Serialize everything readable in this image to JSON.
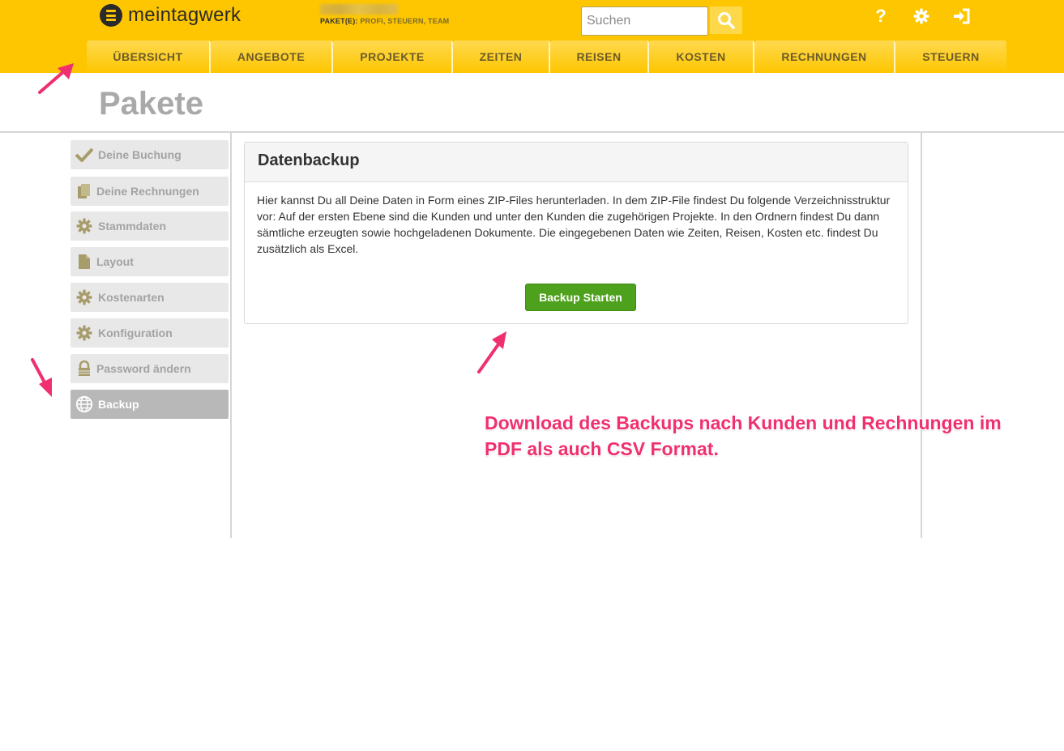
{
  "header": {
    "logo_text": "meintagwerk",
    "package_label": "PAKET(E):",
    "package_value": "PROFI, STEUERN, TEAM",
    "search_placeholder": "Suchen",
    "help_icon": "question-icon",
    "settings_icon": "gear-icon",
    "logout_icon": "sign-in-icon"
  },
  "nav": [
    {
      "label": "ÜBERSICHT"
    },
    {
      "label": "ANGEBOTE"
    },
    {
      "label": "PROJEKTE"
    },
    {
      "label": "ZEITEN"
    },
    {
      "label": "REISEN"
    },
    {
      "label": "KOSTEN"
    },
    {
      "label": "RECHNUNGEN"
    },
    {
      "label": "STEUERN"
    }
  ],
  "page": {
    "title": "Pakete"
  },
  "sidebar": [
    {
      "label": "Deine Buchung",
      "icon": "check-icon"
    },
    {
      "label": "Deine Rechnungen",
      "icon": "documents-icon"
    },
    {
      "label": "Stammdaten",
      "icon": "gear-icon"
    },
    {
      "label": "Layout",
      "icon": "file-icon"
    },
    {
      "label": "Kostenarten",
      "icon": "gear-icon"
    },
    {
      "label": "Konfiguration",
      "icon": "gear-icon"
    },
    {
      "label": "Password ändern",
      "icon": "lock-icon"
    },
    {
      "label": "Backup",
      "icon": "globe-icon",
      "active": true
    }
  ],
  "panel": {
    "title": "Datenbackup",
    "text": "Hier kannst Du all Deine Daten in Form eines ZIP-Files herunterladen. In dem ZIP-File findest Du folgende Verzeichnisstruktur vor: Auf der ersten Ebene sind die Kunden und unter den Kunden die zugehörigen Projekte. In den Ordnern findest Du dann sämtliche erzeugten sowie hochgeladenen Dokumente. Die eingegebenen Daten wie Zeiten, Reisen, Kosten etc. findest Du zusätzlich als Excel.",
    "button_label": "Backup Starten"
  },
  "annotation": {
    "text": "Download des Backups nach Kunden und Rechnungen im PDF als auch CSV Format."
  },
  "colors": {
    "header_bg": "#fec600",
    "button_green": "#4ea11c",
    "annotation_pink": "#f0306e",
    "sidebar_icon": "#a79c6b"
  }
}
